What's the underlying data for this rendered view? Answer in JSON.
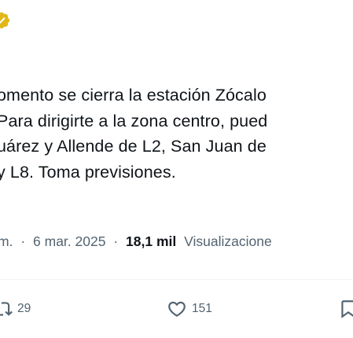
{
  "tweet": {
    "text_lines": [
      "omento se cierra la estación Zócalo",
      " Para dirigirte a la zona centro, pued",
      "uárez y Allende de L2, San Juan de",
      "y L8. Toma previsiones."
    ]
  },
  "meta": {
    "time_fragment": "m.",
    "separator": "·",
    "date": "6 mar. 2025",
    "views_count": "18,1 mil",
    "views_label": "Visualizacione"
  },
  "actions": {
    "retweets": "29",
    "likes": "151"
  },
  "colors": {
    "text": "#0f1419",
    "secondary": "#536471",
    "verified_gold": "#e2b719",
    "divider": "#eff3f4"
  },
  "icons": {
    "badge": "verified-gold-badge-icon",
    "retweet": "retweet-icon",
    "like": "heart-icon",
    "reply": "bookmark-icon"
  }
}
